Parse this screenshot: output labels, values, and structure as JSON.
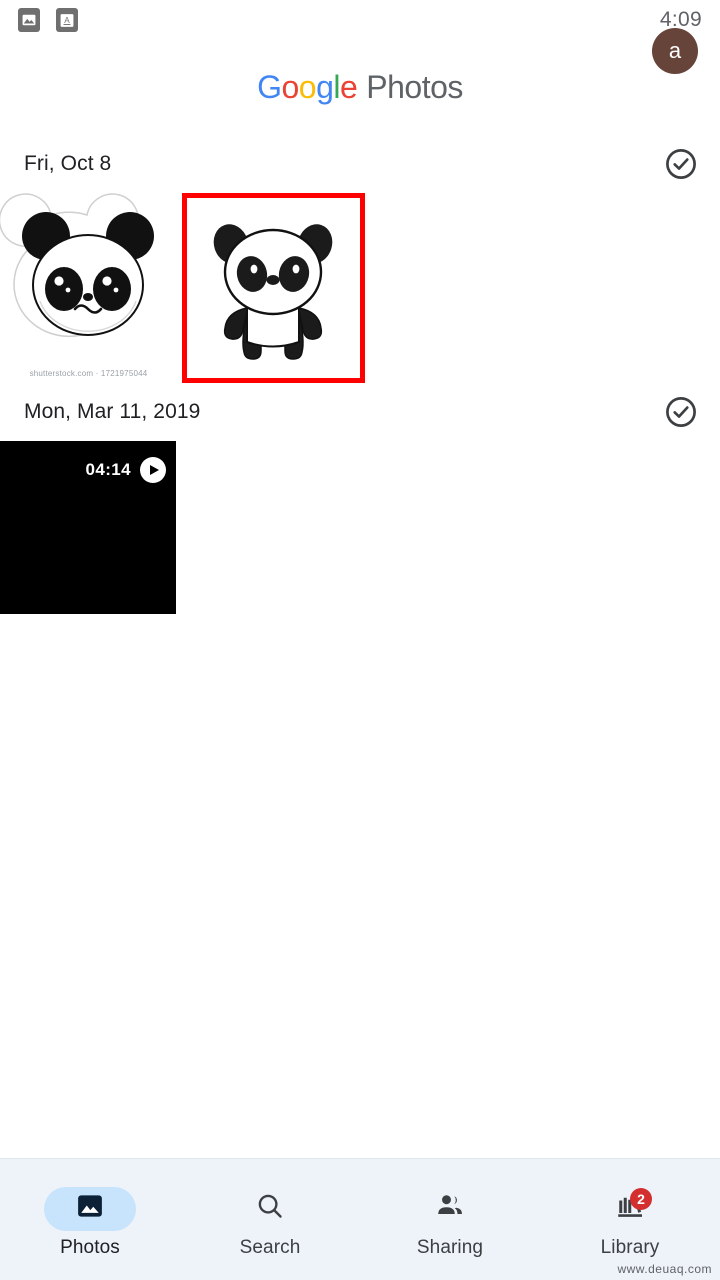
{
  "status_bar": {
    "icons": [
      {
        "name": "photo-notification-icon",
        "glyph": "image"
      },
      {
        "name": "keyboard-language-icon",
        "glyph": "A"
      }
    ],
    "time": "4:09"
  },
  "header": {
    "brand_google": "Google",
    "brand_google_letters": [
      {
        "ch": "G",
        "color": "#4285F4"
      },
      {
        "ch": "o",
        "color": "#EA4335"
      },
      {
        "ch": "o",
        "color": "#FBBC05"
      },
      {
        "ch": "g",
        "color": "#4285F4"
      },
      {
        "ch": "l",
        "color": "#34A853"
      },
      {
        "ch": "e",
        "color": "#EA4335"
      }
    ],
    "brand_suffix": "Photos",
    "avatar_initial": "a",
    "avatar_color": "#67443a"
  },
  "content": {
    "groups": [
      {
        "date": "Fri, Oct 8",
        "select_icon": "check-circle-icon",
        "tiles": [
          {
            "type": "photo",
            "name": "panda-face-photo",
            "selected": false,
            "watermark": "shutterstock.com · 1721975044"
          },
          {
            "type": "photo",
            "name": "panda-body-photo",
            "selected": true,
            "selection_color": "#ff0000",
            "watermark": ""
          }
        ]
      },
      {
        "date": "Mon, Mar 11, 2019",
        "select_icon": "check-circle-icon",
        "tiles": [
          {
            "type": "video",
            "name": "video-thumbnail",
            "selected": false,
            "duration": "04:14",
            "play_icon": "play-icon"
          }
        ]
      }
    ]
  },
  "bottom_nav": {
    "items": [
      {
        "label": "Photos",
        "icon": "photos-icon",
        "active": true,
        "badge": ""
      },
      {
        "label": "Search",
        "icon": "search-icon",
        "active": false,
        "badge": ""
      },
      {
        "label": "Sharing",
        "icon": "sharing-icon",
        "active": false,
        "badge": ""
      },
      {
        "label": "Library",
        "icon": "library-icon",
        "active": false,
        "badge": "2"
      }
    ],
    "active_pill_color": "#c7e4fc",
    "badge_color": "#d32f2f"
  },
  "watermark": "www.deuaq.com"
}
